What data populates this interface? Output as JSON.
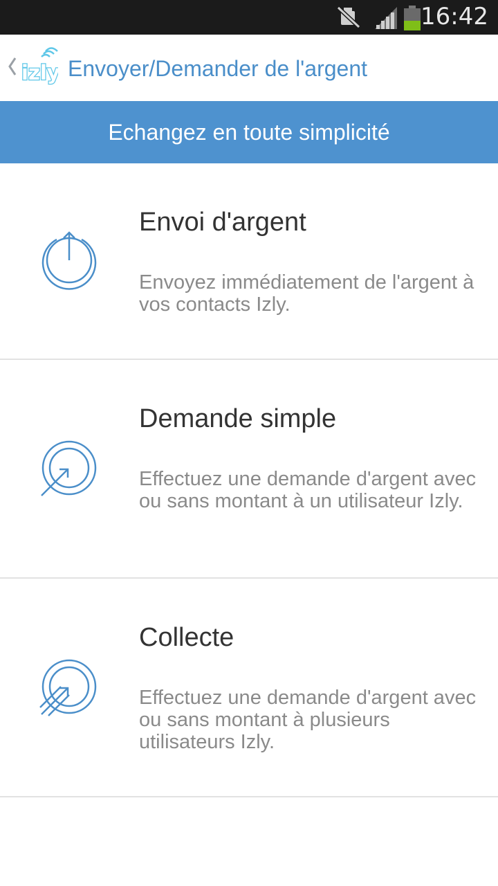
{
  "status_bar": {
    "time": "16:42",
    "icons": [
      "mute-icon",
      "signal-icon",
      "battery-icon"
    ]
  },
  "app_bar": {
    "title": "Envoyer/Demander de l'argent",
    "logo_text": "izly",
    "accent_color": "#4a8ec9"
  },
  "banner": {
    "text": "Echangez en toute simplicité",
    "color": "#4e92cf"
  },
  "options": [
    {
      "title": "Envoi d'argent",
      "description": "Envoyez immédiatement de l'argent à vos contacts Izly.",
      "icon": "send-money-icon"
    },
    {
      "title": "Demande simple",
      "description": "Effectuez une demande d'argent avec ou sans montant à un utilisateur Izly.",
      "icon": "request-money-icon"
    },
    {
      "title": "Collecte",
      "description": "Effectuez une demande d'argent avec ou sans montant à plusieurs utilisateurs Izly.",
      "icon": "collect-money-icon"
    }
  ]
}
